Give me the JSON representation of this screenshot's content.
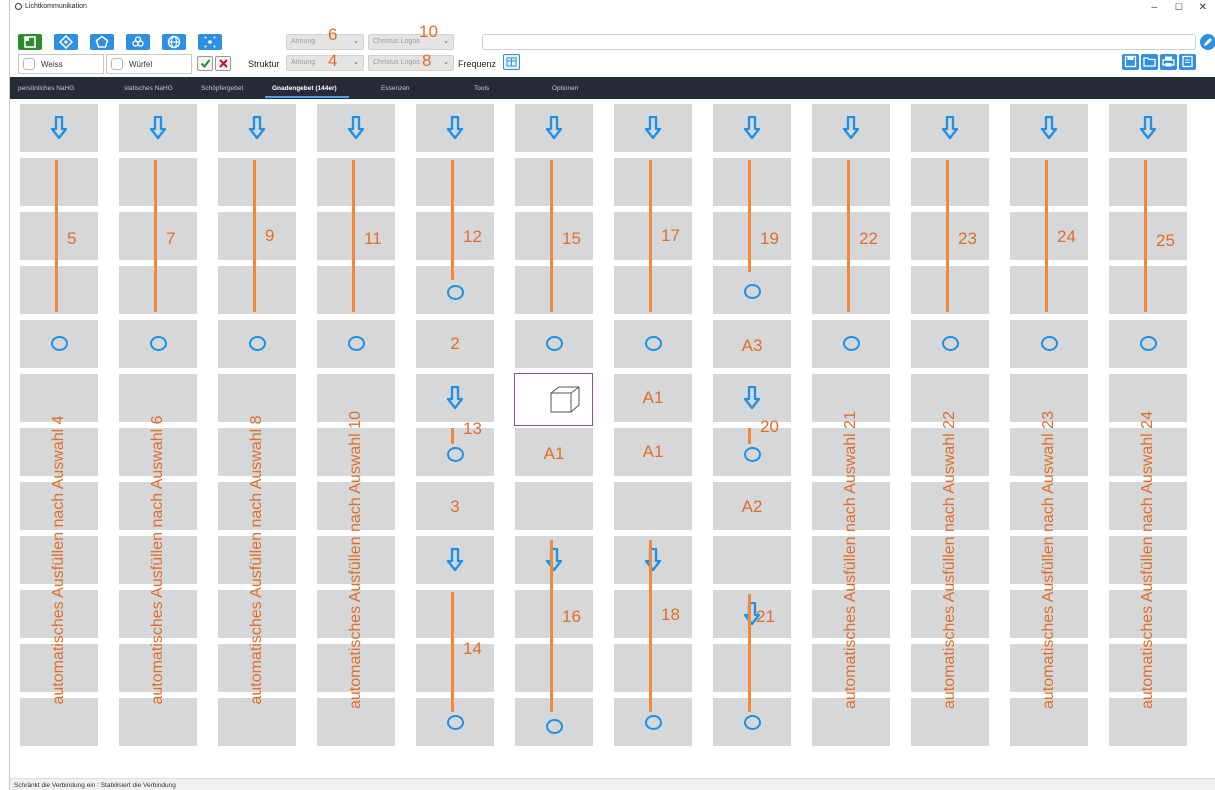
{
  "window": {
    "title": "Lichtkommunikation",
    "min": "–",
    "max": "☐",
    "close": "✕"
  },
  "toolbar": {
    "buttons": [
      "layout-icon",
      "move-icon",
      "pentagon-icon",
      "flower-icon",
      "globe-icon",
      "sparkle-icon"
    ],
    "color_label": "Weiss",
    "shape_label": "Würfel",
    "struktur_label": "Struktur",
    "frequenz_label": "Frequenz",
    "combo_row1_a": "Atmung",
    "combo_row1_b": "Christus Logos",
    "combo_row2_a": "Atmung",
    "combo_row2_b": "Christus Logos",
    "marker_6": "6",
    "marker_10": "10",
    "marker_4": "4",
    "marker_8": "8",
    "right_buttons": [
      "save-icon",
      "folder-icon",
      "print-icon",
      "export-icon"
    ]
  },
  "tabs": [
    {
      "label": "persönliches NaHG",
      "active": false
    },
    {
      "label": "statisches NaHG",
      "active": false
    },
    {
      "label": "Schöpfergebet",
      "active": false
    },
    {
      "label": "Gnadengebet (144er)",
      "active": true
    },
    {
      "label": "Essenzen",
      "active": false
    },
    {
      "label": "Tools",
      "active": false
    },
    {
      "label": "Optionen",
      "active": false
    }
  ],
  "grid": {
    "columns": 12,
    "rows": 12,
    "col_labels_top": [
      "5",
      "7",
      "9",
      "11",
      "12",
      "15",
      "17",
      "19",
      "22",
      "23",
      "24",
      "25"
    ],
    "auto_fill": [
      "automatisches Ausfüllen nach Auswahl 4",
      "automatisches Ausfüllen nach Auswahl 6",
      "automatisches Ausfüllen nach Auswahl 8",
      "automatisches Ausfüllen nach Auswahl 10",
      "automatisches Ausfüllen nach Auswahl 21",
      "automatisches Ausfüllen nach Auswahl 22",
      "automatisches Ausfüllen nach Auswahl 23",
      "automatisches Ausfüllen nach Auswahl 24"
    ],
    "col5": {
      "r4": "2",
      "r6": "13",
      "r8": "3",
      "r11": "14"
    },
    "col6": {
      "selected": "1",
      "r7": "A1",
      "r10": "16"
    },
    "col7": {
      "r5": "A1",
      "r7": "A1",
      "r10": "18"
    },
    "col8": {
      "r4": "A3",
      "r6": "20",
      "r8": "A2",
      "r10": "21"
    }
  },
  "status": {
    "text": "Schränkt die Verbindung ein : Stabilisiert die Verbindung"
  }
}
